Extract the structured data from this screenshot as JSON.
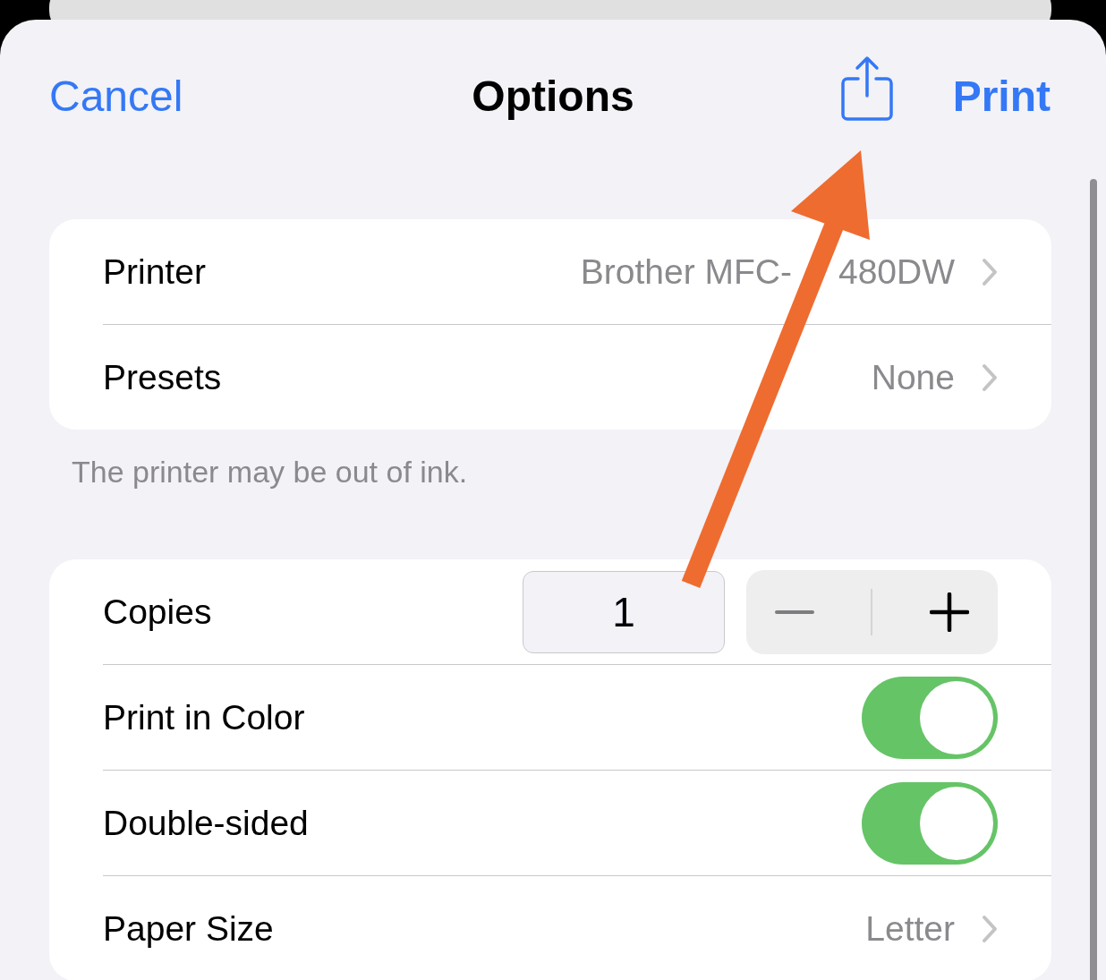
{
  "nav": {
    "cancel": "Cancel",
    "title": "Options",
    "print": "Print"
  },
  "sections": [
    {
      "rows": [
        {
          "kind": "link",
          "label": "Printer",
          "value_parts": [
            "Brother MFC-",
            "480DW"
          ]
        },
        {
          "kind": "link",
          "label": "Presets",
          "value": "None"
        }
      ],
      "footer": "The printer may be out of ink."
    },
    {
      "rows": [
        {
          "kind": "stepper",
          "label": "Copies",
          "value": "1"
        },
        {
          "kind": "toggle",
          "label": "Print in Color",
          "on": true
        },
        {
          "kind": "toggle",
          "label": "Double-sided",
          "on": true
        },
        {
          "kind": "link",
          "label": "Paper Size",
          "value": "Letter"
        }
      ]
    }
  ]
}
